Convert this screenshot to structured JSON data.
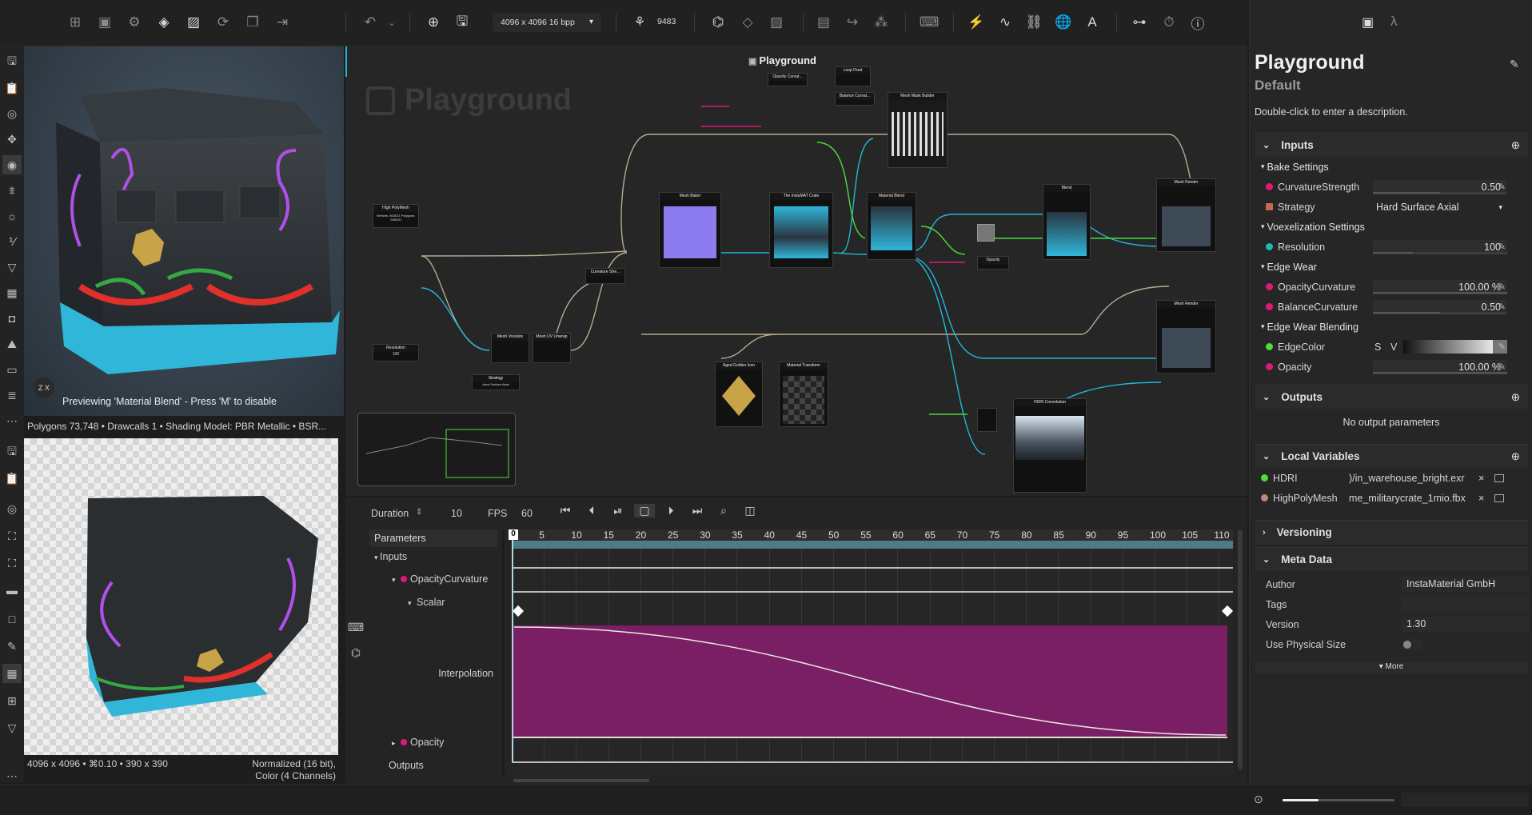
{
  "topbar": {
    "resolution_select": "4096 x 4096 16 bpp",
    "seed_value": "9483"
  },
  "viewport3d": {
    "preview_text": "Previewing 'Material Blend' - Press 'M' to disable",
    "stats": "Polygons 73,748 • Drawcalls 1 • Shading Model: PBR Metallic • BSR..."
  },
  "viewport2d": {
    "info_left": "4096 x 4096 • ⌘0.10 • 390 x 390",
    "info_right_1": "Normalized (16 bit),",
    "info_right_2": "Color (4 Channels)"
  },
  "graph": {
    "tab_title": "Playground",
    "watermark": "Playground",
    "nodes": {
      "opacity_curvature": "Opacity Curvat...",
      "loop_float": "Loop Float",
      "balance_curvature": "Balance Curvat...",
      "mesh_mask_builder": "Mesh Mask Builder",
      "high_poly_mesh": "High PolyMesh",
      "high_poly_sub": "Vertices: 463021 Polygons: 548420",
      "mesh_baker": "Mesh Baker",
      "instamat_crate": "The InstaMAT Crate",
      "material_blend": "Material Blend",
      "blend": "Blend",
      "mesh_render_1": "Mesh Render",
      "mesh_render_2": "Mesh Render",
      "curvature_strength": "Curvature Stre...",
      "resolution": "Resolution",
      "resolution_val": "100",
      "mesh_voxelize": "Mesh Voxelize",
      "mesh_uv_unwrap": "Mesh UV Unwrap",
      "strategy": "Strategy",
      "strategy_val": "Hard Surface Axial",
      "aged_golden_icon": "Aged Golden Icon",
      "material_transform": "Material Transform",
      "opacity": "Opacity",
      "hdri_convolution": "HDRI Convolution"
    }
  },
  "timeline": {
    "duration_label": "Duration",
    "duration_value": "10",
    "fps_label": "FPS",
    "fps_value": "60",
    "parameters_label": "Parameters",
    "tree": {
      "inputs": "Inputs",
      "opacity_curvature": "OpacityCurvature",
      "scalar": "Scalar",
      "interpolation": "Interpolation",
      "opacity": "Opacity",
      "outputs": "Outputs"
    },
    "ruler": [
      "0",
      "5",
      "10",
      "15",
      "20",
      "25",
      "30",
      "35",
      "40",
      "45",
      "50",
      "55",
      "60",
      "65",
      "70",
      "75",
      "80",
      "85",
      "90",
      "95",
      "100",
      "105",
      "110"
    ]
  },
  "right_panel": {
    "title": "Playground",
    "subtitle": "Default",
    "description": "Double-click to enter a description.",
    "inputs_header": "Inputs",
    "groups": {
      "bake_settings": "Bake Settings",
      "voxelization": "Voexelization Settings",
      "edge_wear": "Edge Wear",
      "edge_wear_blending": "Edge Wear Blending"
    },
    "params": {
      "curvature_strength": {
        "label": "CurvatureStrength",
        "value": "0.50",
        "fill": 0.5
      },
      "strategy": {
        "label": "Strategy",
        "value": "Hard Surface Axial"
      },
      "resolution": {
        "label": "Resolution",
        "value": "100",
        "fill": 0.3
      },
      "opacity_curvature": {
        "label": "OpacityCurvature",
        "value": "100.00 %",
        "fill": 1.0
      },
      "balance_curvature": {
        "label": "BalanceCurvature",
        "value": "0.50",
        "fill": 0.5
      },
      "edge_color": {
        "label": "EdgeColor",
        "s": "S",
        "v": "V"
      },
      "opacity": {
        "label": "Opacity",
        "value": "100.00 %",
        "fill": 1.0
      }
    },
    "outputs_header": "Outputs",
    "no_outputs": "No output parameters",
    "local_vars_header": "Local Variables",
    "local_vars": [
      {
        "label": "HDRI",
        "value": ")/in_warehouse_bright.exr"
      },
      {
        "label": "HighPolyMesh",
        "value": "me_militarycrate_1mio.fbx"
      }
    ],
    "versioning_header": "Versioning",
    "metadata_header": "Meta Data",
    "metadata": {
      "author_label": "Author",
      "author": "InstaMaterial GmbH",
      "tags_label": "Tags",
      "tags": "",
      "version_label": "Version",
      "version": "1.30",
      "physical_label": "Use Physical Size"
    },
    "more": "More"
  },
  "colors": {
    "accent": "#e0187a",
    "cyan": "#1fb8d6",
    "green": "#4ddc3a",
    "curve_fill": "#7a1f63"
  }
}
